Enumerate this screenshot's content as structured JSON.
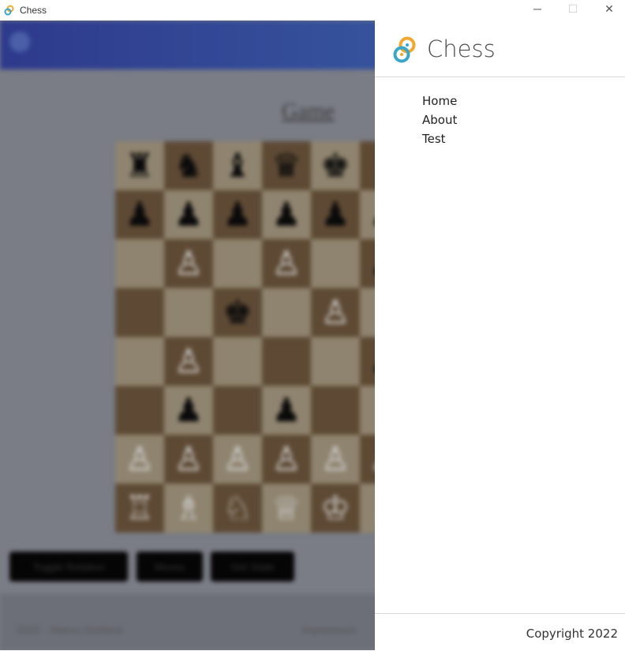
{
  "window": {
    "title": "Chess",
    "minimize_glyph": "─",
    "maximize_glyph": "☐",
    "close_glyph": "✕"
  },
  "background": {
    "heading": "Game",
    "buttons": [
      "Toggle Rotation",
      "Moves",
      "Get State"
    ],
    "footer_left": "2022 - Marco Dorland",
    "footer_mid": "Impressum",
    "board": [
      [
        "♜",
        "♞",
        "♝",
        "♛",
        "♚",
        "♝",
        "♞",
        "♜"
      ],
      [
        "♟",
        "♟",
        "♟",
        "♟",
        "♟",
        "♟",
        "♟",
        "♟"
      ],
      [
        "",
        "♙",
        "",
        "♙",
        "",
        "♟",
        "",
        ""
      ],
      [
        "",
        "",
        "♚",
        "",
        "♙",
        "",
        "",
        ""
      ],
      [
        "",
        "♙",
        "",
        "",
        "",
        "♟",
        "",
        ""
      ],
      [
        "",
        "♟",
        "",
        "♟",
        "",
        "",
        "",
        ""
      ],
      [
        "♙",
        "♙",
        "♙",
        "♙",
        "♙",
        "♙",
        "♙",
        "♙"
      ],
      [
        "♖",
        "♗",
        "♘",
        "♕",
        "♔",
        "♗",
        "♘",
        "♖"
      ]
    ]
  },
  "panel": {
    "title": "Chess",
    "nav": [
      {
        "label": "Home"
      },
      {
        "label": "About"
      },
      {
        "label": "Test"
      }
    ],
    "copyright": "Copyright 2022"
  },
  "colors": {
    "accent_blue": "#2e3a8c",
    "logo_orange": "#f0a830",
    "logo_blue": "#3aa6c8"
  }
}
